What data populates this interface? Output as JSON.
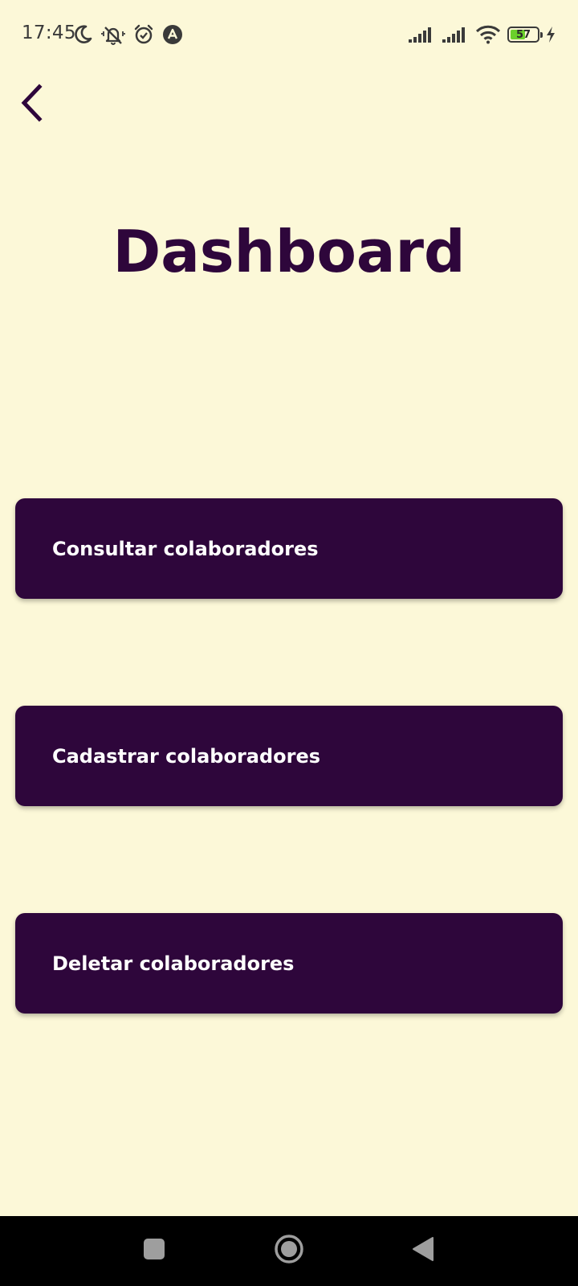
{
  "status_bar": {
    "time": "17:45",
    "battery_level": "57",
    "battery_fraction": 0.57,
    "battery_color": "#6bd02b",
    "left_icons": [
      "moon-icon",
      "vibrate-silent-icon",
      "alarm-icon",
      "app-notification-icon"
    ],
    "right_icons": [
      "signal-icon",
      "signal-icon",
      "wifi-icon",
      "battery-icon",
      "charging-icon"
    ]
  },
  "header": {
    "back_icon": "chevron-left-icon",
    "title": "Dashboard"
  },
  "menu": {
    "consultar_label": "Consultar colaboradores",
    "cadastrar_label": "Cadastrar colaboradores",
    "deletar_label": "Deletar colaboradores"
  },
  "nav_bar": {
    "icons": [
      "recents-square-icon",
      "home-circle-icon",
      "back-triangle-icon"
    ]
  },
  "colors": {
    "background": "#fcf8d8",
    "primary": "#2e063b",
    "button_text": "#ffffff",
    "nav_bar": "#000000"
  }
}
